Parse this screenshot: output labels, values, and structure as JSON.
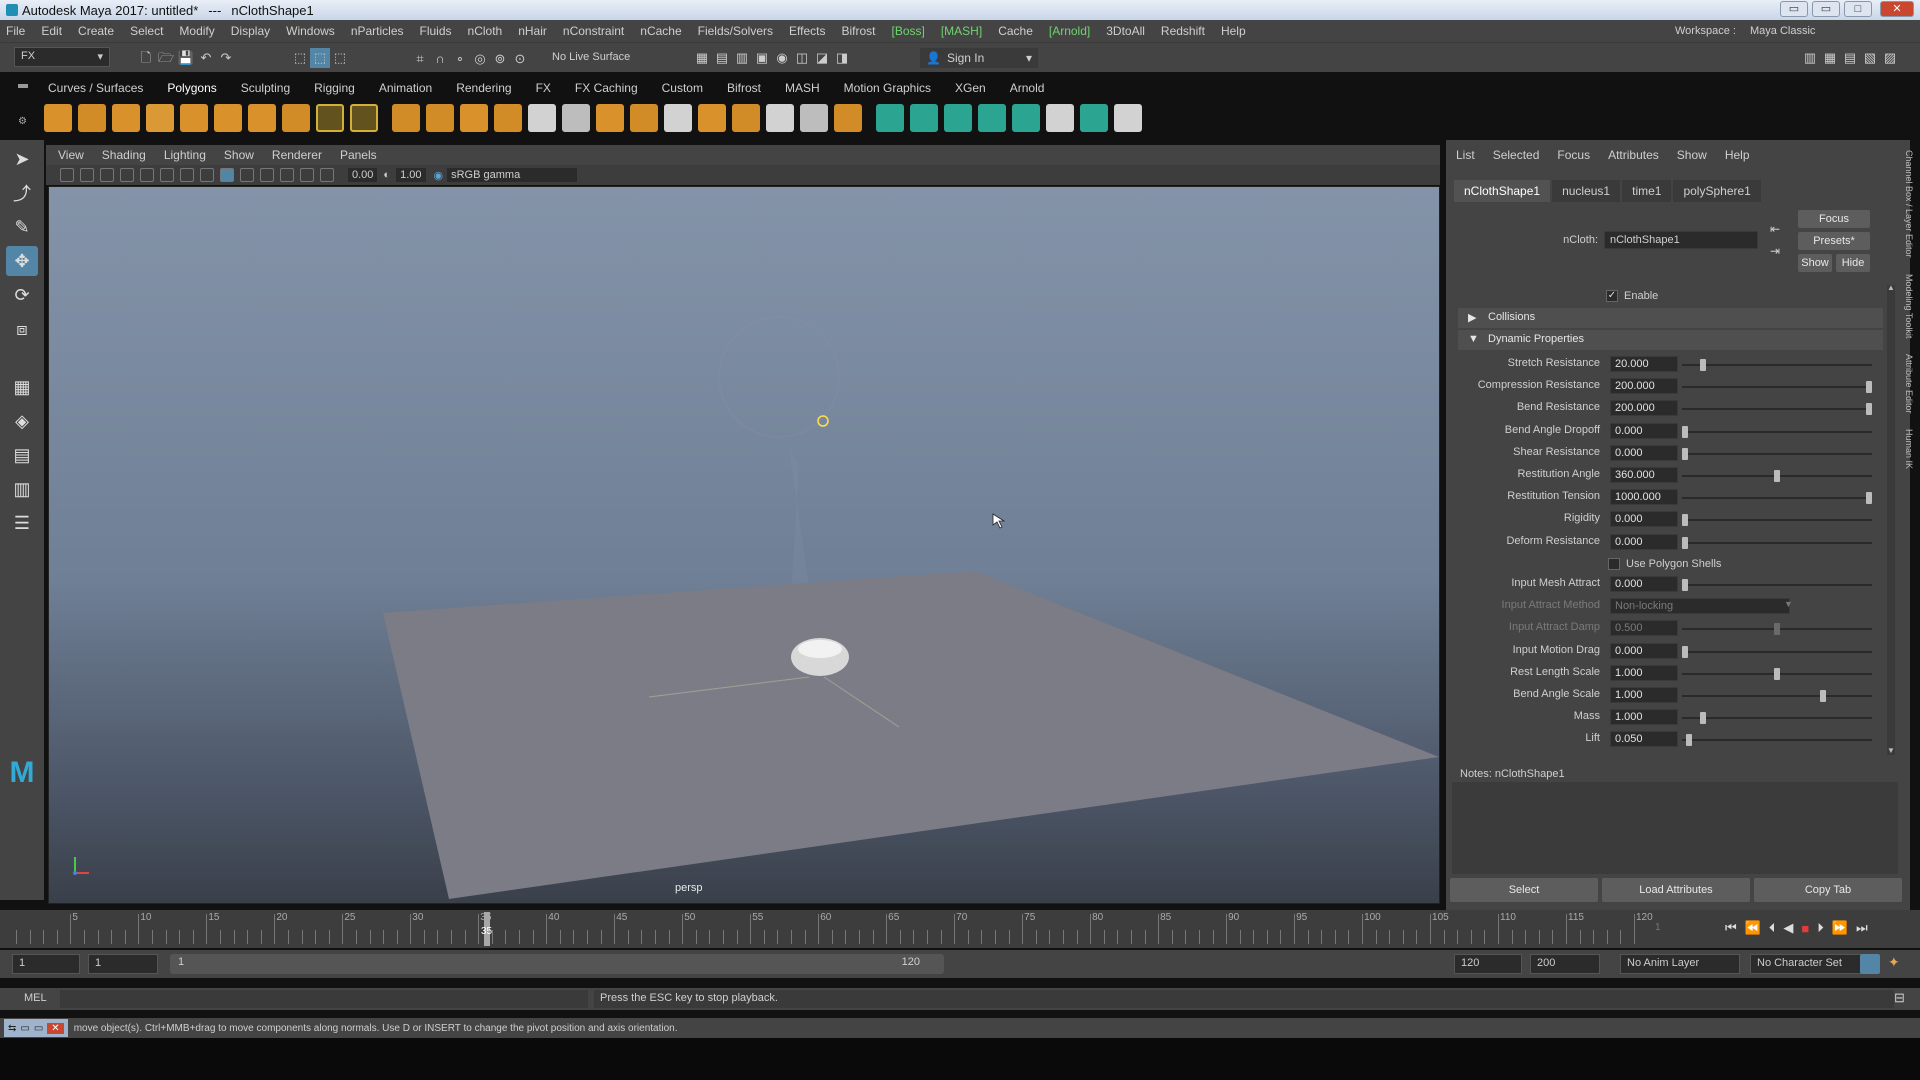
{
  "title": {
    "app": "Autodesk Maya 2017: untitled*",
    "sep": "---",
    "node": "nClothShape1"
  },
  "menubar": [
    "File",
    "Edit",
    "Create",
    "Select",
    "Modify",
    "Display",
    "Windows",
    "nParticles",
    "Fluids",
    "nCloth",
    "nHair",
    "nConstraint",
    "nCache",
    "Fields/Solvers",
    "Effects",
    "Bifrost",
    "[Boss]",
    "[MASH]",
    "Cache",
    "[Arnold]",
    "3DtoAll",
    "Redshift",
    "Help"
  ],
  "workspace": {
    "label": "Workspace :",
    "value": "Maya Classic"
  },
  "status": {
    "menuset": "FX",
    "live_surface": "No Live Surface",
    "sign_in": "Sign In"
  },
  "shelf_tabs": [
    "Curves / Surfaces",
    "Polygons",
    "Sculpting",
    "Rigging",
    "Animation",
    "Rendering",
    "FX",
    "FX Caching",
    "Custom",
    "Bifrost",
    "MASH",
    "Motion Graphics",
    "XGen",
    "Arnold"
  ],
  "shelf_active": "Polygons",
  "panel_menu": [
    "View",
    "Shading",
    "Lighting",
    "Show",
    "Renderer",
    "Panels"
  ],
  "panel_tools": {
    "exposure": "0.00",
    "gamma": "1.00",
    "colorspace": "sRGB gamma"
  },
  "camera": "persp",
  "attr_menu": [
    "List",
    "Selected",
    "Focus",
    "Attributes",
    "Show",
    "Help"
  ],
  "attr_tabs": [
    "nClothShape1",
    "nucleus1",
    "time1",
    "polySphere1"
  ],
  "attr_node": {
    "label": "nCloth:",
    "value": "nClothShape1"
  },
  "attr_buttons": {
    "focus": "Focus",
    "presets": "Presets*",
    "show": "Show",
    "hide": "Hide"
  },
  "enable": "Enable",
  "sections": {
    "collisions": "Collisions",
    "dynamic": "Dynamic Properties"
  },
  "attributes": [
    {
      "label": "Stretch Resistance",
      "value": "20.000",
      "pos": 0.1
    },
    {
      "label": "Compression Resistance",
      "value": "200.000",
      "pos": 1.0
    },
    {
      "label": "Bend Resistance",
      "value": "200.000",
      "pos": 1.0
    },
    {
      "label": "Bend Angle Dropoff",
      "value": "0.000",
      "pos": 0.0
    },
    {
      "label": "Shear Resistance",
      "value": "0.000",
      "pos": 0.0
    },
    {
      "label": "Restitution Angle",
      "value": "360.000",
      "pos": 0.5
    },
    {
      "label": "Restitution Tension",
      "value": "1000.000",
      "pos": 1.0
    },
    {
      "label": "Rigidity",
      "value": "0.000",
      "pos": 0.0
    },
    {
      "label": "Deform Resistance",
      "value": "0.000",
      "pos": 0.0
    }
  ],
  "use_polygon_shells": "Use Polygon Shells",
  "attributes2": [
    {
      "label": "Input Mesh Attract",
      "value": "0.000",
      "pos": 0.0,
      "dim": false
    },
    {
      "label": "Input Attract Method",
      "value": "Non-locking",
      "pos": null,
      "dim": true
    },
    {
      "label": "Input Attract Damp",
      "value": "0.500",
      "pos": 0.5,
      "dim": true
    },
    {
      "label": "Input Motion Drag",
      "value": "0.000",
      "pos": 0.0,
      "dim": false
    },
    {
      "label": "Rest Length Scale",
      "value": "1.000",
      "pos": 0.5,
      "dim": false
    },
    {
      "label": "Bend Angle Scale",
      "value": "1.000",
      "pos": 0.75,
      "dim": false
    },
    {
      "label": "Mass",
      "value": "1.000",
      "pos": 0.1,
      "dim": false
    },
    {
      "label": "Lift",
      "value": "0.050",
      "pos": 0.02,
      "dim": false
    }
  ],
  "notes": "Notes:  nClothShape1",
  "bottom_buttons": {
    "select": "Select",
    "load": "Load Attributes",
    "copy": "Copy Tab"
  },
  "timeline": {
    "ticks": [
      "5",
      "10",
      "15",
      "20",
      "25",
      "30",
      "35",
      "40",
      "45",
      "50",
      "55",
      "60",
      "65",
      "70",
      "75",
      "80",
      "85",
      "90",
      "95",
      "100",
      "105",
      "110",
      "115",
      "120"
    ],
    "current": "35",
    "frame_field": "1"
  },
  "range": {
    "start": "1",
    "start2": "1",
    "slider_start": "1",
    "slider_end": "120",
    "end": "120",
    "end2": "200",
    "anim_layer": "No Anim Layer",
    "char_set": "No Character Set"
  },
  "cmd": {
    "lang": "MEL",
    "feedback": "Press the ESC key to stop playback."
  },
  "help_text": "move object(s). Ctrl+MMB+drag to move components along normals. Use D or INSERT to change the pivot position and axis orientation.",
  "side_tabs": [
    "Channel Box / Layer Editor",
    "Modeling Toolkit",
    "Attribute Editor",
    "Human IK"
  ],
  "colors": {
    "accent": "#5285a6",
    "green": "#6fd46f",
    "stop": "#e03c3c"
  }
}
